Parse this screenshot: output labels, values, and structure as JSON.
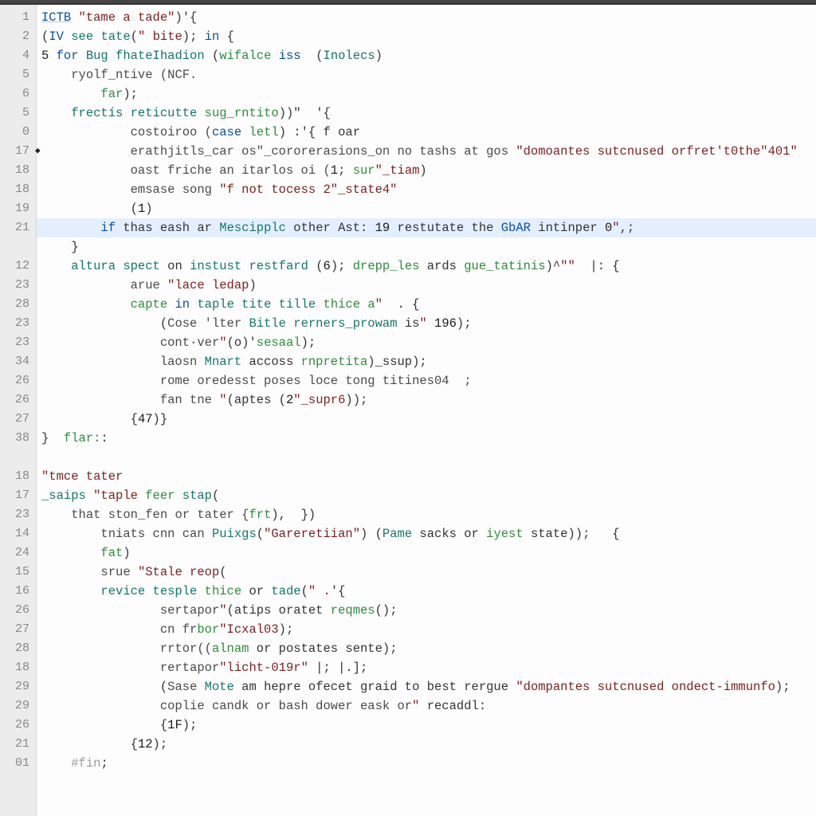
{
  "gutter": [
    "1",
    "2",
    "4",
    "5",
    "6",
    "5",
    "0",
    "17",
    "18",
    "18",
    "19",
    "21",
    "",
    "12",
    "23",
    "28",
    "23",
    "23",
    "34",
    "26",
    "26",
    "27",
    "38",
    "",
    "18",
    "17",
    "23",
    "14",
    "24",
    "15",
    "16",
    "26",
    "27",
    "28",
    "18",
    "29",
    "29",
    "26",
    "21",
    "01"
  ],
  "marker_row_index": 7,
  "marker_glyph": "◆",
  "highlight_row_index": 11,
  "lines": [
    {
      "indent": 0,
      "tokens": [
        [
          "tk-id",
          "ICTB"
        ],
        [
          "tk-pun",
          " "
        ],
        [
          "tk-str",
          "\"tame a tade\""
        ],
        [
          "tk-pun",
          ")'{"
        ]
      ]
    },
    {
      "indent": 0,
      "tokens": [
        [
          "tk-pun",
          "("
        ],
        [
          "tk-kw",
          "IV"
        ],
        [
          "tk-pun",
          " "
        ],
        [
          "tk-def",
          "see"
        ],
        [
          "tk-pun",
          " "
        ],
        [
          "tk-def",
          "tate"
        ],
        [
          "tk-pun",
          "("
        ],
        [
          "tk-str",
          "\" bite"
        ],
        [
          "tk-pun",
          "); "
        ],
        [
          "tk-kw",
          "in"
        ],
        [
          "tk-pun",
          " {"
        ]
      ]
    },
    {
      "indent": 0,
      "tokens": [
        [
          "tk-num",
          "5 "
        ],
        [
          "tk-kw",
          "for"
        ],
        [
          "tk-pun",
          " "
        ],
        [
          "tk-def",
          "Bug fhateIhadion"
        ],
        [
          "tk-pun",
          " ("
        ],
        [
          "tk-green",
          "wifalce"
        ],
        [
          "tk-pun",
          " "
        ],
        [
          "tk-kw",
          "iss"
        ],
        [
          "tk-pun",
          "  ("
        ],
        [
          "tk-def",
          "Inolecs"
        ],
        [
          "tk-pun",
          ")"
        ]
      ]
    },
    {
      "indent": 1,
      "tokens": [
        [
          "tk-var",
          "ryolf_ntive (NCF."
        ]
      ]
    },
    {
      "indent": 2,
      "tokens": [
        [
          "tk-green",
          "far"
        ],
        [
          "tk-pun",
          ");"
        ]
      ]
    },
    {
      "indent": 1,
      "tokens": [
        [
          "tk-def",
          "frectís reticutte"
        ],
        [
          "tk-pun",
          " "
        ],
        [
          "tk-green",
          "sug_rntito"
        ],
        [
          "tk-pun",
          "))\"  '{"
        ]
      ]
    },
    {
      "indent": 3,
      "tokens": [
        [
          "tk-var",
          "costoiroo ("
        ],
        [
          "tk-kw",
          "case"
        ],
        [
          "tk-pun",
          " "
        ],
        [
          "tk-green",
          "letl"
        ],
        [
          "tk-pun",
          ") :'{ f oar"
        ]
      ]
    },
    {
      "indent": 3,
      "tokens": [
        [
          "tk-var",
          "erathjitls_car os\"_cororerasions_on no tashs at gos "
        ],
        [
          "tk-str",
          "\"domoantes sutcnused orfret't0the\"401\""
        ]
      ]
    },
    {
      "indent": 3,
      "tokens": [
        [
          "tk-var",
          "oast friche an itarlos oi ("
        ],
        [
          "tk-num",
          "1"
        ],
        [
          "tk-pun",
          "; "
        ],
        [
          "tk-green",
          "sur"
        ],
        [
          "tk-str",
          "\"_tiam"
        ],
        [
          "tk-pun",
          ")"
        ]
      ]
    },
    {
      "indent": 3,
      "tokens": [
        [
          "tk-var",
          "emsase song "
        ],
        [
          "tk-str",
          "\"f not tocess 2\"_state4\""
        ]
      ]
    },
    {
      "indent": 3,
      "tokens": [
        [
          "tk-pun",
          "("
        ],
        [
          "tk-num",
          "1"
        ],
        [
          "tk-pun",
          ")"
        ]
      ]
    },
    {
      "indent": 2,
      "tokens": [
        [
          "tk-kw",
          "if"
        ],
        [
          "tk-pun",
          " thas eash ar "
        ],
        [
          "tk-def",
          "Mescipplc"
        ],
        [
          "tk-pun",
          " other Ast: "
        ],
        [
          "tk-num",
          "19"
        ],
        [
          "tk-pun",
          " restutate the "
        ],
        [
          "tk-typ",
          "GbAR"
        ],
        [
          "tk-pun",
          " intinper "
        ],
        [
          "tk-num",
          "0"
        ],
        [
          "tk-str",
          "\""
        ],
        [
          "tk-pun",
          ",;"
        ]
      ]
    },
    {
      "indent": 1,
      "tokens": [
        [
          "tk-pun",
          "}"
        ]
      ]
    },
    {
      "indent": 1,
      "tokens": [
        [
          "tk-def",
          "altura spect"
        ],
        [
          "tk-pun",
          " on "
        ],
        [
          "tk-def",
          "instust restfard"
        ],
        [
          "tk-pun",
          " ("
        ],
        [
          "tk-num",
          "6"
        ],
        [
          "tk-pun",
          "); "
        ],
        [
          "tk-green",
          "drepp_les"
        ],
        [
          "tk-pun",
          " ards "
        ],
        [
          "tk-green",
          "gue_tatinis"
        ],
        [
          "tk-pun",
          ")^"
        ],
        [
          "tk-str",
          "\"\""
        ],
        [
          "tk-pun",
          "  |: {"
        ]
      ]
    },
    {
      "indent": 3,
      "tokens": [
        [
          "tk-var",
          "arue "
        ],
        [
          "tk-str",
          "\"lace ledap"
        ],
        [
          "tk-pun",
          ")"
        ]
      ]
    },
    {
      "indent": 3,
      "tokens": [
        [
          "tk-green",
          "capte"
        ],
        [
          "tk-pun",
          " "
        ],
        [
          "tk-kw",
          "in"
        ],
        [
          "tk-pun",
          " "
        ],
        [
          "tk-def",
          "taple tite tille"
        ],
        [
          "tk-pun",
          " "
        ],
        [
          "tk-green",
          "thice a"
        ],
        [
          "tk-str",
          "\""
        ],
        [
          "tk-pun",
          "  . {"
        ]
      ]
    },
    {
      "indent": 4,
      "tokens": [
        [
          "tk-pun",
          "("
        ],
        [
          "tk-var",
          "Cose 'lter "
        ],
        [
          "tk-def",
          "Bitle rerners_prowam"
        ],
        [
          "tk-pun",
          " is"
        ],
        [
          "tk-str",
          "\" "
        ],
        [
          "tk-num",
          "196"
        ],
        [
          "tk-pun",
          ");"
        ]
      ]
    },
    {
      "indent": 4,
      "tokens": [
        [
          "tk-var",
          "cont·ver"
        ],
        [
          "tk-str",
          "\""
        ],
        [
          "tk-pun",
          "(o)'"
        ],
        [
          "tk-green",
          "sesaal"
        ],
        [
          "tk-pun",
          ");"
        ]
      ]
    },
    {
      "indent": 4,
      "tokens": [
        [
          "tk-var",
          "laosn "
        ],
        [
          "tk-def",
          "Mnart"
        ],
        [
          "tk-pun",
          " accoss "
        ],
        [
          "tk-green",
          "rnpretita"
        ],
        [
          "tk-pun",
          ")_ssup);"
        ]
      ]
    },
    {
      "indent": 4,
      "tokens": [
        [
          "tk-var",
          "rome oredesst poses loce tong titines04  ;"
        ]
      ]
    },
    {
      "indent": 4,
      "tokens": [
        [
          "tk-var",
          "fan tne "
        ],
        [
          "tk-str",
          "\""
        ],
        [
          "tk-pun",
          "(aptes ("
        ],
        [
          "tk-num",
          "2"
        ],
        [
          "tk-str",
          "\"_supr6"
        ],
        [
          "tk-pun",
          "));"
        ]
      ]
    },
    {
      "indent": 3,
      "tokens": [
        [
          "tk-pun",
          "{"
        ],
        [
          "tk-num",
          "47"
        ],
        [
          "tk-pun",
          ")}"
        ]
      ]
    },
    {
      "indent": 0,
      "tokens": [
        [
          "tk-pun",
          "}  "
        ],
        [
          "tk-green",
          "flar:"
        ],
        [
          "tk-pun",
          ":"
        ]
      ]
    },
    {
      "indent": 0,
      "tokens": []
    },
    {
      "indent": 0,
      "tokens": [
        [
          "tk-str",
          "\"tmce tater"
        ]
      ]
    },
    {
      "indent": 0,
      "tokens": [
        [
          "tk-def",
          "_saips"
        ],
        [
          "tk-pun",
          " "
        ],
        [
          "tk-str",
          "\"taple"
        ],
        [
          "tk-pun",
          " "
        ],
        [
          "tk-green",
          "feer"
        ],
        [
          "tk-pun",
          " "
        ],
        [
          "tk-def",
          "stap"
        ],
        [
          "tk-pun",
          "("
        ]
      ]
    },
    {
      "indent": 1,
      "tokens": [
        [
          "tk-var",
          "that ston_fen or tater {"
        ],
        [
          "tk-green",
          "frt"
        ],
        [
          "tk-pun",
          "),  })"
        ]
      ]
    },
    {
      "indent": 2,
      "tokens": [
        [
          "tk-var",
          "tniats cnn can "
        ],
        [
          "tk-def",
          "Puixgs"
        ],
        [
          "tk-pun",
          "("
        ],
        [
          "tk-str",
          "\"Gareretiian\""
        ],
        [
          "tk-pun",
          ") ("
        ],
        [
          "tk-def",
          "Pame"
        ],
        [
          "tk-pun",
          " sacks or "
        ],
        [
          "tk-green",
          "iyest"
        ],
        [
          "tk-pun",
          " state));   {"
        ]
      ]
    },
    {
      "indent": 2,
      "tokens": [
        [
          "tk-green",
          "fat"
        ],
        [
          "tk-pun",
          ")"
        ]
      ]
    },
    {
      "indent": 2,
      "tokens": [
        [
          "tk-var",
          "srue "
        ],
        [
          "tk-str",
          "\"Stale reop"
        ],
        [
          "tk-pun",
          "("
        ]
      ]
    },
    {
      "indent": 2,
      "tokens": [
        [
          "tk-def",
          "revice tesple"
        ],
        [
          "tk-pun",
          " "
        ],
        [
          "tk-green",
          "thice"
        ],
        [
          "tk-pun",
          " or "
        ],
        [
          "tk-def",
          "tade"
        ],
        [
          "tk-pun",
          "("
        ],
        [
          "tk-str",
          "\" ."
        ],
        [
          "tk-pun",
          "'{"
        ]
      ]
    },
    {
      "indent": 4,
      "tokens": [
        [
          "tk-var",
          "sertapor"
        ],
        [
          "tk-str",
          "\""
        ],
        [
          "tk-pun",
          "(atips oratet "
        ],
        [
          "tk-green",
          "reqmes"
        ],
        [
          "tk-pun",
          "();"
        ]
      ]
    },
    {
      "indent": 4,
      "tokens": [
        [
          "tk-var",
          "cn fr"
        ],
        [
          "tk-green",
          "bor"
        ],
        [
          "tk-str",
          "\"Icxal03"
        ],
        [
          "tk-pun",
          ");"
        ]
      ]
    },
    {
      "indent": 4,
      "tokens": [
        [
          "tk-var",
          "rrtor(("
        ],
        [
          "tk-green",
          "alnam"
        ],
        [
          "tk-pun",
          " or postates sente);"
        ]
      ]
    },
    {
      "indent": 4,
      "tokens": [
        [
          "tk-var",
          "rertapor"
        ],
        [
          "tk-str",
          "\"licht-019r\""
        ],
        [
          "tk-pun",
          " |; |.];"
        ]
      ]
    },
    {
      "indent": 4,
      "tokens": [
        [
          "tk-pun",
          "("
        ],
        [
          "tk-var",
          "Sase "
        ],
        [
          "tk-def",
          "Mote"
        ],
        [
          "tk-pun",
          " am hepre ofecet graid to best rergue "
        ],
        [
          "tk-str",
          "\"dompantes sutcnused ondect-immunfo"
        ],
        [
          "tk-pun",
          ");"
        ]
      ]
    },
    {
      "indent": 4,
      "tokens": [
        [
          "tk-var",
          "coplie candk or bash dower eask or"
        ],
        [
          "tk-str",
          "\""
        ],
        [
          "tk-pun",
          " recaddl:"
        ]
      ]
    },
    {
      "indent": 4,
      "tokens": [
        [
          "tk-pun",
          "{"
        ],
        [
          "tk-num",
          "1F"
        ],
        [
          "tk-pun",
          ");"
        ]
      ]
    },
    {
      "indent": 3,
      "tokens": [
        [
          "tk-pun",
          "{"
        ],
        [
          "tk-num",
          "12"
        ],
        [
          "tk-pun",
          ");"
        ]
      ]
    },
    {
      "indent": 1,
      "tokens": [
        [
          "tk-dim",
          "#fin"
        ],
        [
          "tk-pun",
          ";"
        ]
      ]
    }
  ],
  "indent_unit": "    "
}
